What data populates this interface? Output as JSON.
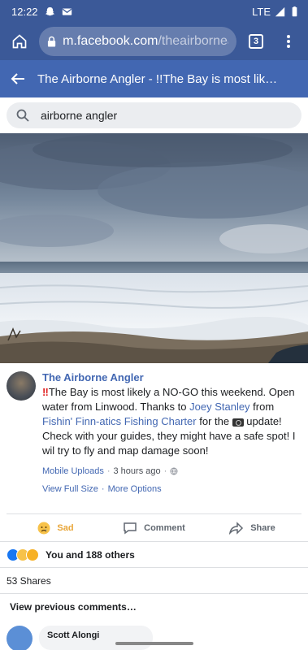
{
  "status_bar": {
    "time": "12:22",
    "network": "LTE"
  },
  "browser": {
    "url_host": "m.facebook.com",
    "url_path": "/theairbornean",
    "tab_count": "3"
  },
  "title_bar": {
    "title": "The Airborne Angler - !!The Bay is most lik…"
  },
  "search": {
    "value": "airborne angler"
  },
  "post": {
    "author": "The Airborne Angler",
    "text_1": "The Bay is most likely a NO-GO this weekend. Open water from Linwood. Thanks to ",
    "mention_1": "Joey Stanley",
    "text_2": " from ",
    "mention_2": "Fishin' Finn-atics Fishing Charter",
    "text_3": " for the ",
    "text_4": " update! Check with your guides, they might have a safe spot! I wil try to fly and map damage soon!",
    "album": "Mobile Uploads",
    "time": "3 hours ago",
    "view_full": "View Full Size",
    "more_options": "More Options"
  },
  "actions": {
    "sad": "Sad",
    "comment": "Comment",
    "share": "Share"
  },
  "reactions": {
    "text": "You and 188 others"
  },
  "shares": {
    "text": "53 Shares"
  },
  "comments": {
    "prev_label": "View previous comments…",
    "first_name": "Scott Alongi"
  },
  "colors": {
    "fb_blue": "#3b5998",
    "title_blue": "#4267b2",
    "sad_yellow": "#e8a537"
  }
}
